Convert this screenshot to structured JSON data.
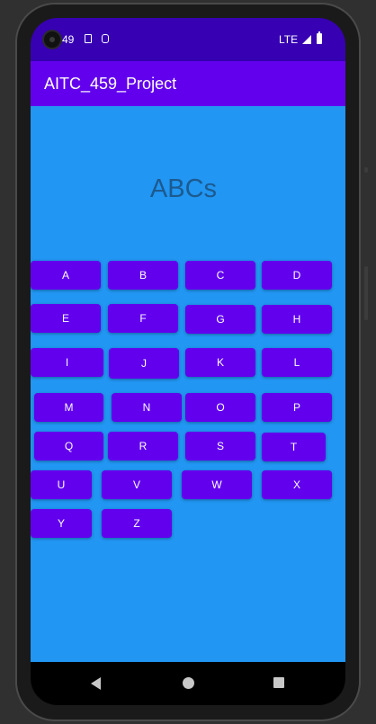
{
  "status_bar": {
    "time": "49",
    "network": "LTE",
    "icons": [
      "sd-card-icon",
      "clipboard-icon",
      "signal-icon",
      "battery-icon"
    ]
  },
  "app_bar": {
    "title": "AITC_459_Project",
    "color": "#6200ee"
  },
  "main": {
    "heading": "ABCs",
    "background": "#2196f3",
    "letters": [
      "A",
      "B",
      "C",
      "D",
      "E",
      "F",
      "G",
      "H",
      "I",
      "J",
      "K",
      "L",
      "M",
      "N",
      "O",
      "P",
      "Q",
      "R",
      "S",
      "T",
      "U",
      "V",
      "W",
      "X",
      "Y",
      "Z"
    ]
  },
  "nav_bar": {
    "icons": [
      "back-icon",
      "home-icon",
      "recents-icon"
    ]
  }
}
